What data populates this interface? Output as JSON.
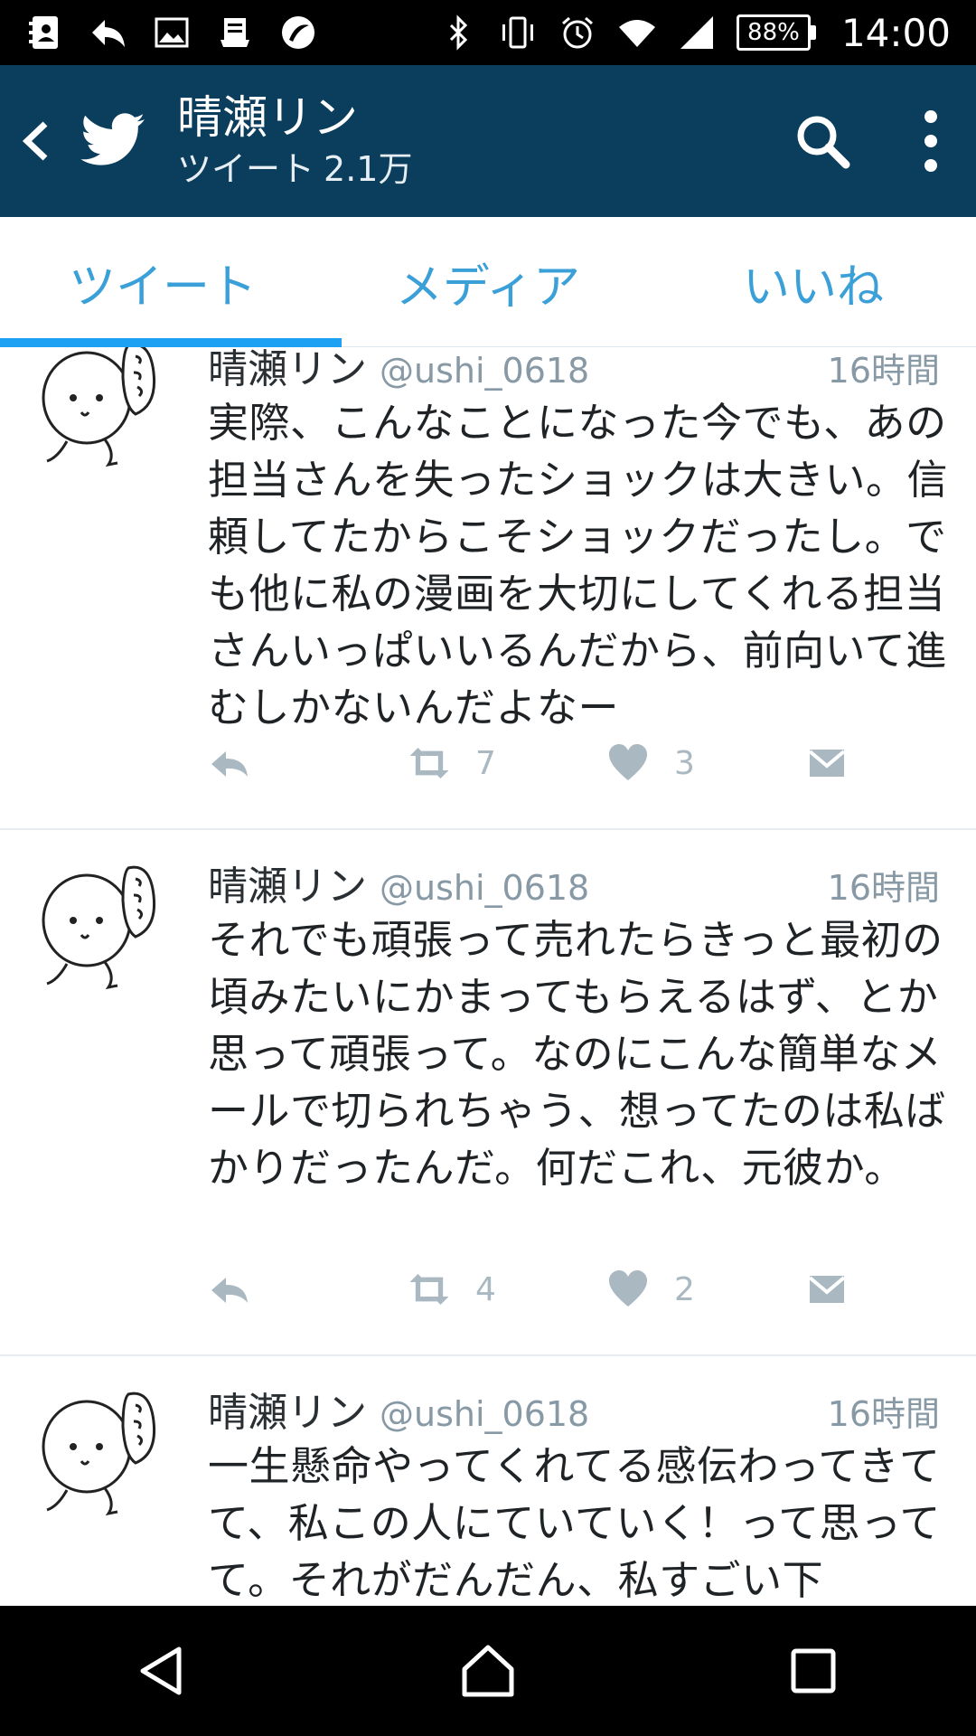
{
  "status_bar": {
    "battery": "88%",
    "battery_level": 0.88,
    "time": "14:00",
    "left_icons": [
      "contacts-icon",
      "reply-arrow-icon",
      "image-icon",
      "clipboard-icon",
      "app-circle-icon"
    ],
    "right_icons": [
      "bluetooth-icon",
      "vibrate-icon",
      "alarm-icon",
      "wifi-icon",
      "cell-signal-icon"
    ]
  },
  "app_bar": {
    "title": "晴瀬リン",
    "subtitle_label": "ツイート",
    "subtitle_count": "2.1万",
    "background": "#0b3d5c"
  },
  "tabs": [
    {
      "label": "ツイート",
      "active": true
    },
    {
      "label": "メディア",
      "active": false
    },
    {
      "label": "いいね",
      "active": false
    }
  ],
  "colors": {
    "accent": "#1da1f2",
    "tab_text": "#3ba0d8",
    "meta": "#8899a6"
  },
  "tweets": [
    {
      "name": "晴瀬リン",
      "handle": "@ushi_0618",
      "time": "16時間",
      "text": "実際、こんなことになった今でも、あの担当さんを失ったショックは大きい。信頼してたからこそショックだったし。でも他に私の漫画を大切にしてくれる担当さんいっぱいいるんだから、前向いて進むしかないんだよなー",
      "retweets": "7",
      "likes": "3"
    },
    {
      "name": "晴瀬リン",
      "handle": "@ushi_0618",
      "time": "16時間",
      "text": "それでも頑張って売れたらきっと最初の頃みたいにかまってもらえるはず、とか思って頑張って。なのにこんな簡単なメールで切られちゃう、想ってたのは私ばかりだったんだ。何だこれ、元彼か。",
      "retweets": "4",
      "likes": "2"
    },
    {
      "name": "晴瀬リン",
      "handle": "@ushi_0618",
      "time": "16時間",
      "text": "一生懸命やってくれてる感伝わってきてて、私この人にていていく！って思ってて。それがだんだん、私すごい下"
    }
  ]
}
